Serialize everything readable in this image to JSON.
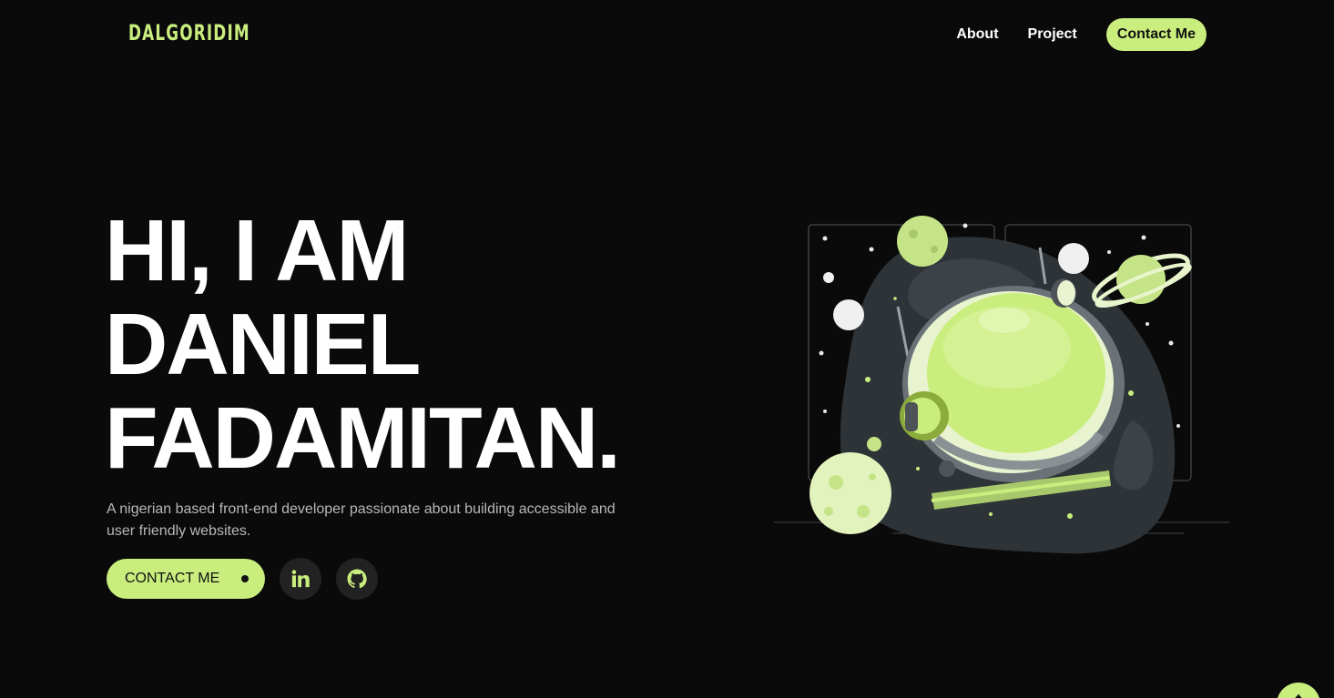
{
  "header": {
    "logo": "DALGORIDIM",
    "nav": [
      {
        "label": "About"
      },
      {
        "label": "Project"
      },
      {
        "label": "Contact Me"
      }
    ]
  },
  "hero": {
    "title_lines": [
      "HI, I AM",
      "DANIEL",
      "FADAMITAN."
    ],
    "subtitle": "A nigerian based front-end developer passionate about building accessible and user friendly websites.",
    "contact_button": "CONTACT ME"
  },
  "social": [
    {
      "icon": "linkedin-icon"
    },
    {
      "icon": "github-icon"
    }
  ],
  "illustration": {
    "icon": "astronaut-helmet-space-illustration"
  },
  "colors": {
    "background": "#0a0a0a",
    "accent": "#c9ee7e",
    "text": "#ffffff",
    "muted": "#b8b8b8",
    "social_bg": "#222222"
  }
}
